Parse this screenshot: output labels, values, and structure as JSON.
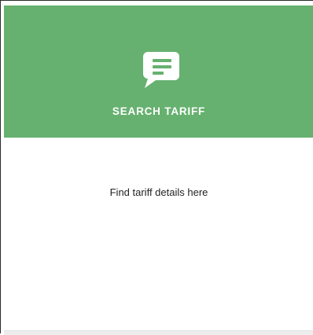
{
  "card": {
    "icon": "chat-message-icon",
    "title": "SEARCH TARIFF",
    "description": "Find tariff details here"
  },
  "colors": {
    "header_background": "#66b16f",
    "header_text": "#ffffff",
    "body_text": "#222222",
    "footer_strip": "#ededed"
  }
}
